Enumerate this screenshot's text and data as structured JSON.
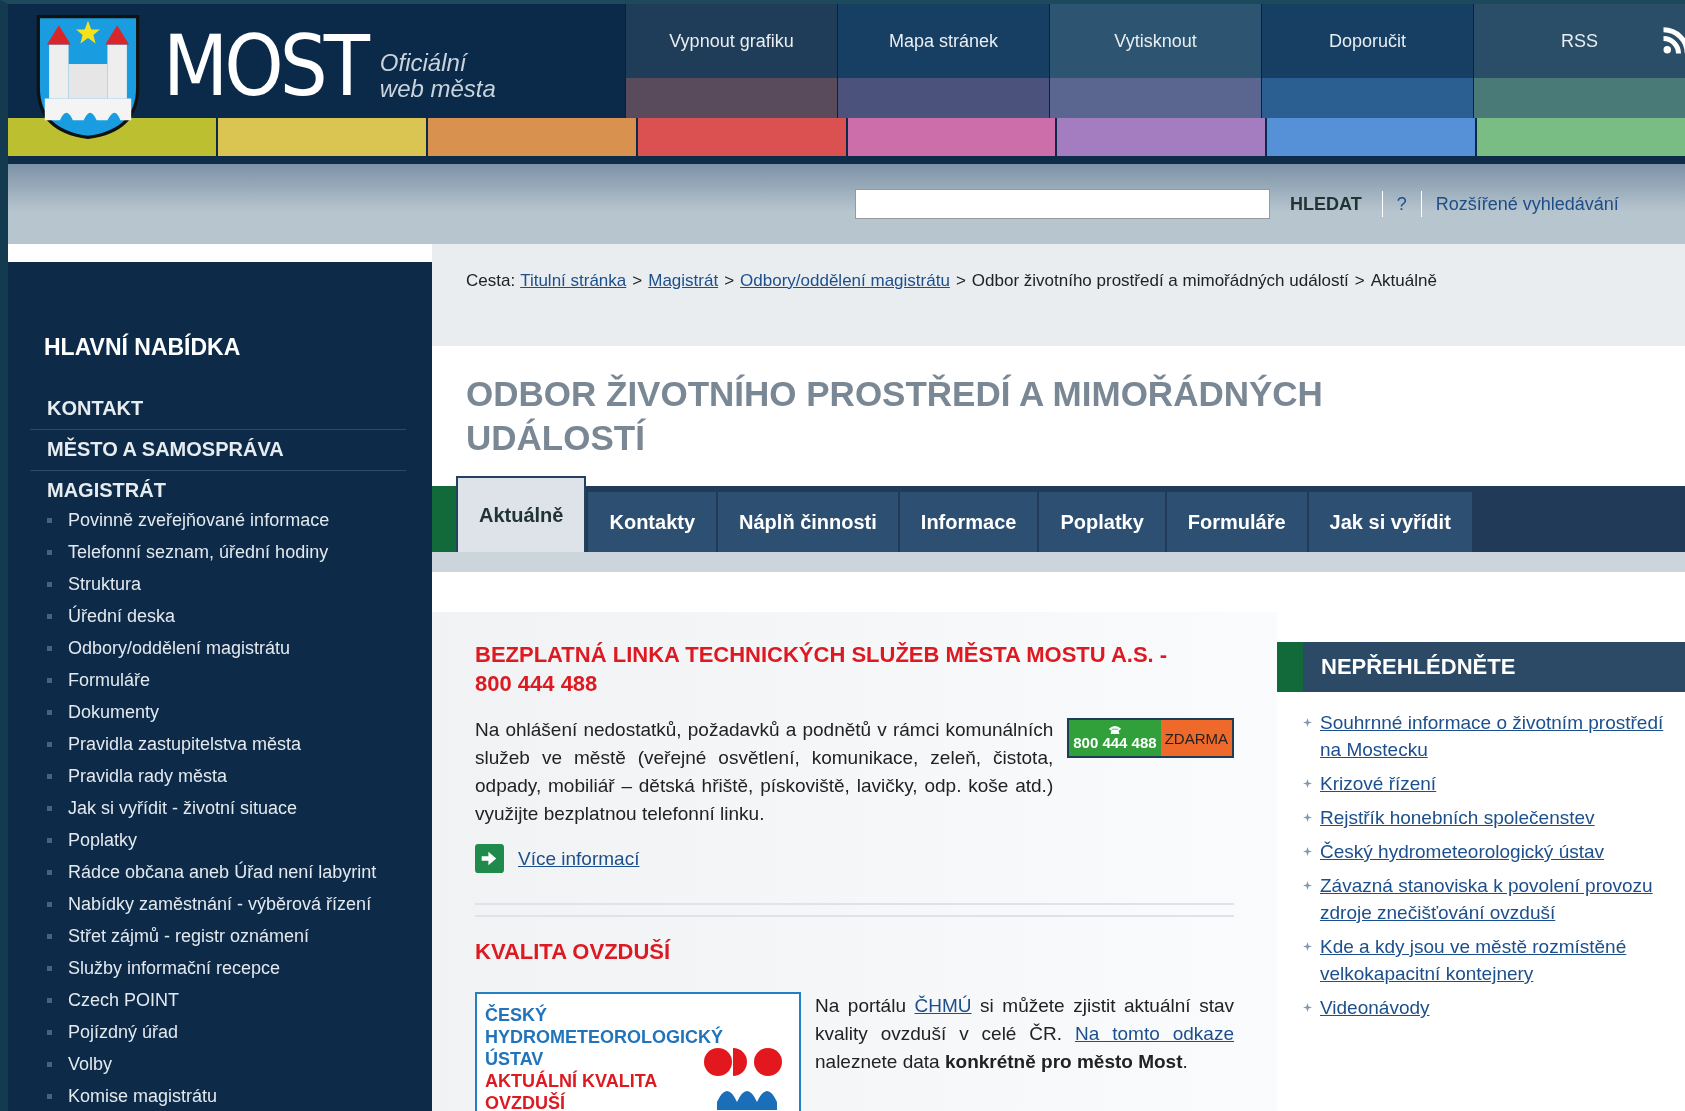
{
  "header": {
    "logo_title": "MOST",
    "logo_subtitle": [
      "Oficiální",
      "web města"
    ],
    "top_links": [
      {
        "label": "Vypnout grafiku",
        "kind": "text"
      },
      {
        "label": "Mapa stránek",
        "kind": "text"
      },
      {
        "label": "Vytisknout",
        "kind": "text"
      },
      {
        "label": "Doporučit",
        "kind": "text"
      },
      {
        "label": "RSS",
        "kind": "rss"
      }
    ]
  },
  "search": {
    "button": "HLEDAT",
    "help": "?",
    "advanced": "Rozšířené vyhledávání"
  },
  "sidebar": {
    "heading": "HLAVNÍ NABÍDKA",
    "items": [
      {
        "label": "KONTAKT"
      },
      {
        "label": "MĚSTO A SAMOSPRÁVA"
      },
      {
        "label": "MAGISTRÁT",
        "children": [
          {
            "label": "Povinně zveřejňované informace"
          },
          {
            "label": "Telefonní seznam, úřední hodiny"
          },
          {
            "label": "Struktura"
          },
          {
            "label": "Úřední deska"
          },
          {
            "label": "Odbory/oddělení magistrátu"
          },
          {
            "label": "Formuláře"
          },
          {
            "label": "Dokumenty"
          },
          {
            "label": "Pravidla zastupitelstva města"
          },
          {
            "label": "Pravidla rady města"
          },
          {
            "label": "Jak si vyřídit - životní situace"
          },
          {
            "label": "Poplatky"
          },
          {
            "label": "Rádce občana aneb Úřad není labyrint"
          },
          {
            "label": "Nabídky zaměstnání - výběrová řízení"
          },
          {
            "label": "Střet zájmů - registr oznámení"
          },
          {
            "label": "Služby informační recepce"
          },
          {
            "label": "Czech POINT"
          },
          {
            "label": "Pojízdný úřad"
          },
          {
            "label": "Volby"
          },
          {
            "label": "Komise magistrátu"
          }
        ]
      }
    ]
  },
  "breadcrumb": {
    "prefix": "Cesta:",
    "separator": ">",
    "items": [
      {
        "label": "Titulní stránka",
        "kind": "link"
      },
      {
        "label": "Magistrát",
        "kind": "link"
      },
      {
        "label": "Odbory/oddělení magistrátu",
        "kind": "link"
      },
      {
        "label": "Odbor životního prostředí a mimořádných událostí",
        "kind": "text"
      },
      {
        "label": "Aktuálně",
        "kind": "text"
      }
    ]
  },
  "page_title": "ODBOR ŽIVOTNÍHO PROSTŘEDÍ A MIMOŘÁDNÝCH UDÁLOSTÍ",
  "tabs": [
    {
      "label": "Aktuálně",
      "selected": true
    },
    {
      "label": "Kontakty",
      "selected": false
    },
    {
      "label": "Náplň činnosti",
      "selected": false
    },
    {
      "label": "Informace",
      "selected": false
    },
    {
      "label": "Poplatky",
      "selected": false
    },
    {
      "label": "Formuláře",
      "selected": false
    },
    {
      "label": "Jak si vyřídit",
      "selected": false
    }
  ],
  "articles": [
    {
      "heading": "BEZPLATNÁ LINKA TECHNICKÝCH SLUŽEB MĚSTA MOSTU A.S. - 800 444 488",
      "badge": {
        "phone": "800 444 488",
        "label": "ZDARMA"
      },
      "body": "Na ohlášení nedostatků, požadavků a podnětů v rámci komunálních služeb ve městě (veřejné osvětlení, komunikace, zeleň, čistota, odpady, mobiliář – dětská hřiště, pískoviště, lavičky, odp. koše atd.) využijte bezplatnou telefonní linku.",
      "more_link": "Více informací"
    },
    {
      "heading": "KVALITA OVZDUŠÍ",
      "banner": {
        "institute": "ČESKÝ HYDROMETEOROLOGICKÝ ÚSTAV",
        "subtitle": "AKTUÁLNÍ KVALITA OVZDUŠÍ"
      },
      "parts": [
        {
          "text": "Na portálu ",
          "kind": "text"
        },
        {
          "text": "ČHMÚ",
          "kind": "link"
        },
        {
          "text": " si můžete zjistit aktuální stav kvality ovzduší v celé ČR. ",
          "kind": "text"
        },
        {
          "text": "Na tomto odkaze",
          "kind": "link"
        },
        {
          "text": " naleznete data ",
          "kind": "text"
        },
        {
          "text": "konkrétně pro město Most",
          "kind": "bold"
        },
        {
          "text": ".",
          "kind": "text"
        }
      ]
    }
  ],
  "aside": {
    "heading": "NEPŘEHLÉDNĚTE",
    "links": [
      "Souhrnné informace o životním prostředí na Mostecku",
      "Krizové řízení",
      "Rejstřík honebních společenstev",
      "Český hydrometeorologický ústav",
      "Závazná stanoviska k povolení provozu zdroje znečišťování ovzduší",
      "Kde a kdy jsou ve městě rozmístěné velkokapacitní kontejnery",
      "Videonávody"
    ]
  }
}
